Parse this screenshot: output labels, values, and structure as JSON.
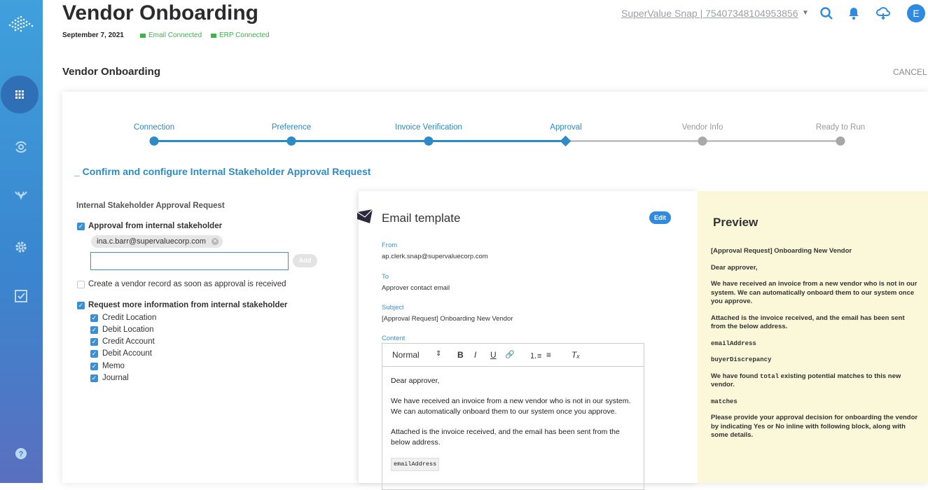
{
  "header": {
    "title": "Vendor Onboarding",
    "date": "September 7, 2021",
    "email_status": "Email Connected",
    "erp_status": "ERP Connected",
    "account": "SuperValue Snap | 75407348104953856",
    "avatar_initial": "E"
  },
  "sidebar": {
    "icons": [
      "logo-icon",
      "apps-grid-icon",
      "sync-eye-icon",
      "verify-icon",
      "gear-icon",
      "checklist-icon",
      "help-icon"
    ]
  },
  "page": {
    "section_title": "Vendor Onboarding",
    "cancel_label": "CANCEL"
  },
  "stepper": {
    "steps": [
      "Connection",
      "Preference",
      "Invoice Verification",
      "Approval",
      "Vendor Info",
      "Ready to Run"
    ],
    "current_step": 4,
    "active_color": "#2c8ac7",
    "inactive_color": "#bdbdbd"
  },
  "confirm": {
    "heading": "_ Confirm and configure Internal Stakeholder Approval Request"
  },
  "form": {
    "heading": "Internal Stakeholder Approval Request",
    "approval_label": "Approval from internal stakeholder",
    "chip_email": "ina.c.barr@supervaluecorp.com",
    "input_value": "",
    "add_label": "Add",
    "create_record_label": "Create a vendor record as soon as approval is received",
    "request_more_label": "Request more information from internal stakeholder",
    "sub_options": [
      "Credit Location",
      "Debit Location",
      "Credit Account",
      "Debit Account",
      "Memo",
      "Journal"
    ]
  },
  "email": {
    "title": "Email template",
    "edit_label": "Edit",
    "from_label": "From",
    "from_value": "ap.clerk.snap@supervaluecorp.com",
    "to_label": "To",
    "to_value": "Approver contact email",
    "subject_label": "Subject",
    "subject_value": "[Approval Request] Onboarding New Vendor",
    "content_label": "Content",
    "toolbar": {
      "format": "Normal",
      "format_caret": "⇕",
      "bold": "B",
      "italic": "I",
      "underline": "U",
      "link": "🔗",
      "ordered_list": "⒈≡",
      "bullet_list": "≡",
      "clear": "Tₓ"
    },
    "body": {
      "greeting": "Dear approver,",
      "p1": "We have received an invoice from a new vendor who is not in our system. We can automatically onboard them to our system once you approve.",
      "p2": "Attached is the invoice received, and the email has been sent from the below address.",
      "token": "emailAddress"
    }
  },
  "preview": {
    "title": "Preview",
    "subject": "[Approval Request] Onboarding New Vendor",
    "greeting": "Dear approver,",
    "p1": "We have received an invoice from a new vendor who is not in our system.  We can automatically onboard them to our system once you approve.",
    "p2": "Attached is the invoice received, and the email has been sent from the below address.",
    "token1": "emailAddress",
    "token2": "buyerDiscrepancy",
    "p3_before": "We have found ",
    "p3_token": "total",
    "p3_after": " existing potential matches to this new vendor.",
    "token3": "matches",
    "p4": "Please provide your approval decision for onboarding the vendor by indicating Yes or No inline with following block, along with some details."
  }
}
